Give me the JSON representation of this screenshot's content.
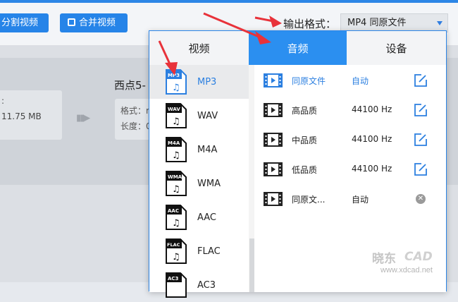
{
  "toolbar": {
    "split_label": "分割视频",
    "merge_label": "合并视频",
    "format_label": "输出格式：",
    "format_value": "MP4  同原文件"
  },
  "file": {
    "meta_colon": ":",
    "size": "11.75 MB",
    "name": "西点5-",
    "format_label": "格式：r",
    "length_label": "长度：0"
  },
  "popup": {
    "tabs": [
      {
        "label": "视频"
      },
      {
        "label": "音频"
      },
      {
        "label": "设备"
      }
    ],
    "formats": [
      {
        "badge": "MP3",
        "name": "MP3"
      },
      {
        "badge": "WAV",
        "name": "WAV"
      },
      {
        "badge": "M4A",
        "name": "M4A"
      },
      {
        "badge": "WMA",
        "name": "WMA"
      },
      {
        "badge": "AAC",
        "name": "AAC"
      },
      {
        "badge": "FLAC",
        "name": "FLAC"
      },
      {
        "badge": "AC3",
        "name": "AC3"
      }
    ],
    "presets": [
      {
        "name": "同原文件",
        "rate": "自动"
      },
      {
        "name": "高品质",
        "rate": "44100 Hz"
      },
      {
        "name": "中品质",
        "rate": "44100 Hz"
      },
      {
        "name": "低品质",
        "rate": "44100 Hz"
      },
      {
        "name": "同原文...",
        "rate": "自动"
      }
    ],
    "remove_glyph": "✕"
  },
  "watermark": {
    "cn": "晓东",
    "cad": "CAD",
    "url": "www.xdcad.net"
  },
  "colors": {
    "accent": "#2b8ff0",
    "selected_text": "#2b7fe0",
    "annotation_arrow": "#e8323a"
  }
}
